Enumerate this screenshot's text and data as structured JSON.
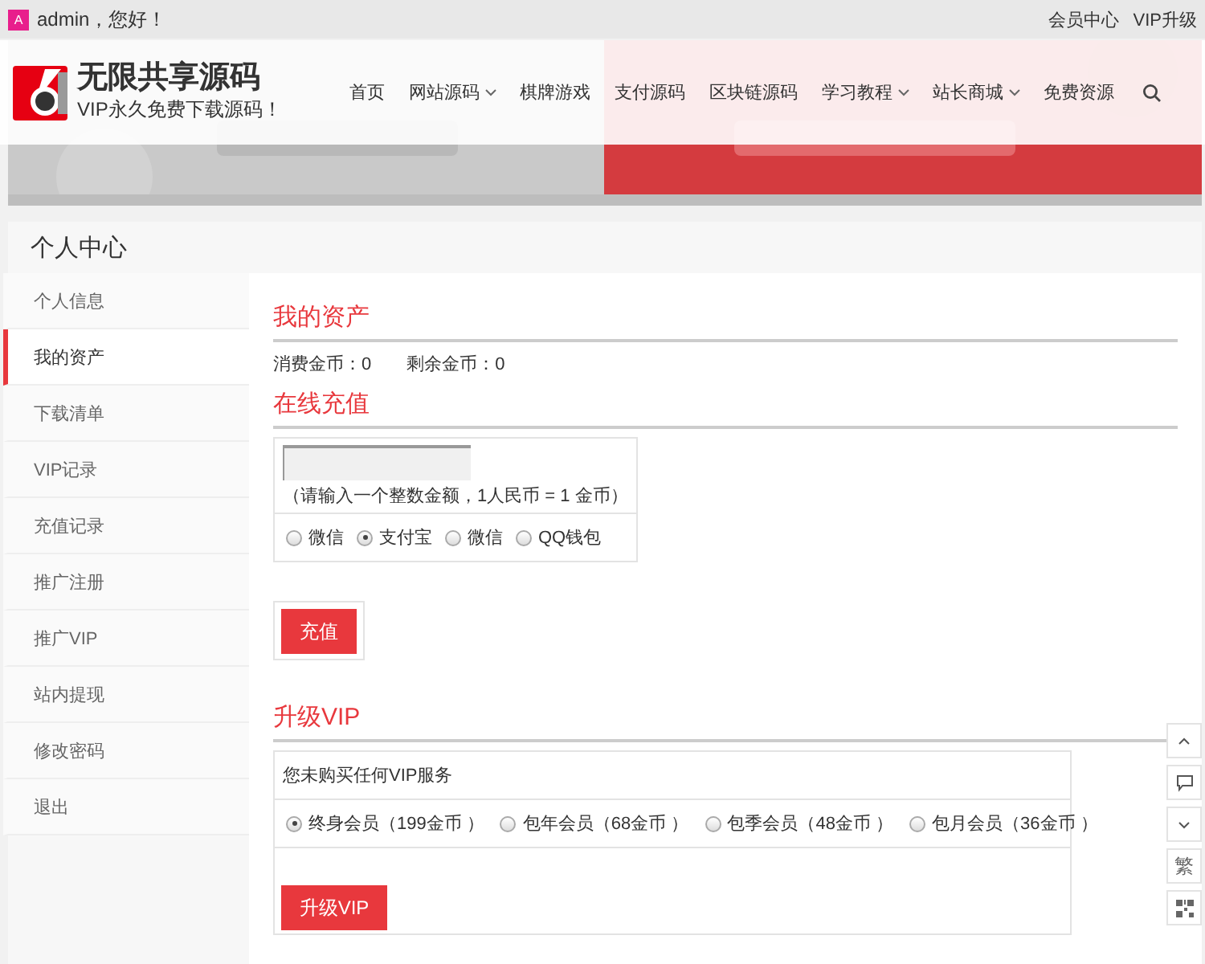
{
  "topbar": {
    "avatar_letter": "A",
    "greeting": "admin，您好！",
    "links": [
      "会员中心",
      "VIP升级"
    ]
  },
  "header": {
    "logo_title": "无限共享源码",
    "logo_slogan": "VIP永久免费下载源码！",
    "nav": [
      {
        "label": "首页",
        "dropdown": false
      },
      {
        "label": "网站源码",
        "dropdown": true
      },
      {
        "label": "棋牌游戏",
        "dropdown": false
      },
      {
        "label": "支付源码",
        "dropdown": false
      },
      {
        "label": "区块链源码",
        "dropdown": false
      },
      {
        "label": "学习教程",
        "dropdown": true
      },
      {
        "label": "站长商城",
        "dropdown": true
      },
      {
        "label": "免费资源",
        "dropdown": false
      }
    ]
  },
  "panel_title": "个人中心",
  "sidebar": [
    {
      "label": "个人信息",
      "selected": false
    },
    {
      "label": "我的资产",
      "selected": true
    },
    {
      "label": "下载清单",
      "selected": false
    },
    {
      "label": "VIP记录",
      "selected": false
    },
    {
      "label": "充值记录",
      "selected": false
    },
    {
      "label": "推广注册",
      "selected": false
    },
    {
      "label": "推广VIP",
      "selected": false
    },
    {
      "label": "站内提现",
      "selected": false
    },
    {
      "label": "修改密码",
      "selected": false
    },
    {
      "label": "退出",
      "selected": false
    }
  ],
  "assets": {
    "title": "我的资产",
    "stats": [
      "消费金币：0",
      "剩余金币：0"
    ]
  },
  "recharge": {
    "title": "在线充值",
    "hint": "（请输入一个整数金额，1人民币 = 1 金币）",
    "methods": [
      {
        "label": "微信",
        "selected": false
      },
      {
        "label": "支付宝",
        "selected": true
      },
      {
        "label": "微信",
        "selected": false
      },
      {
        "label": "QQ钱包",
        "selected": false
      }
    ],
    "button": "充值"
  },
  "vip": {
    "title": "升级VIP",
    "status": "您未购买任何VIP服务",
    "plans": [
      {
        "label": "终身会员（199金币 ）",
        "selected": true
      },
      {
        "label": "包年会员（68金币 ）",
        "selected": false
      },
      {
        "label": "包季会员（48金币 ）",
        "selected": false
      },
      {
        "label": "包月会员（36金币 ）",
        "selected": false
      }
    ],
    "button": "升级VIP"
  },
  "side_tools": [
    {
      "kind": "up"
    },
    {
      "kind": "chat"
    },
    {
      "kind": "down"
    },
    {
      "kind": "text",
      "label": "繁"
    },
    {
      "kind": "qr"
    }
  ]
}
